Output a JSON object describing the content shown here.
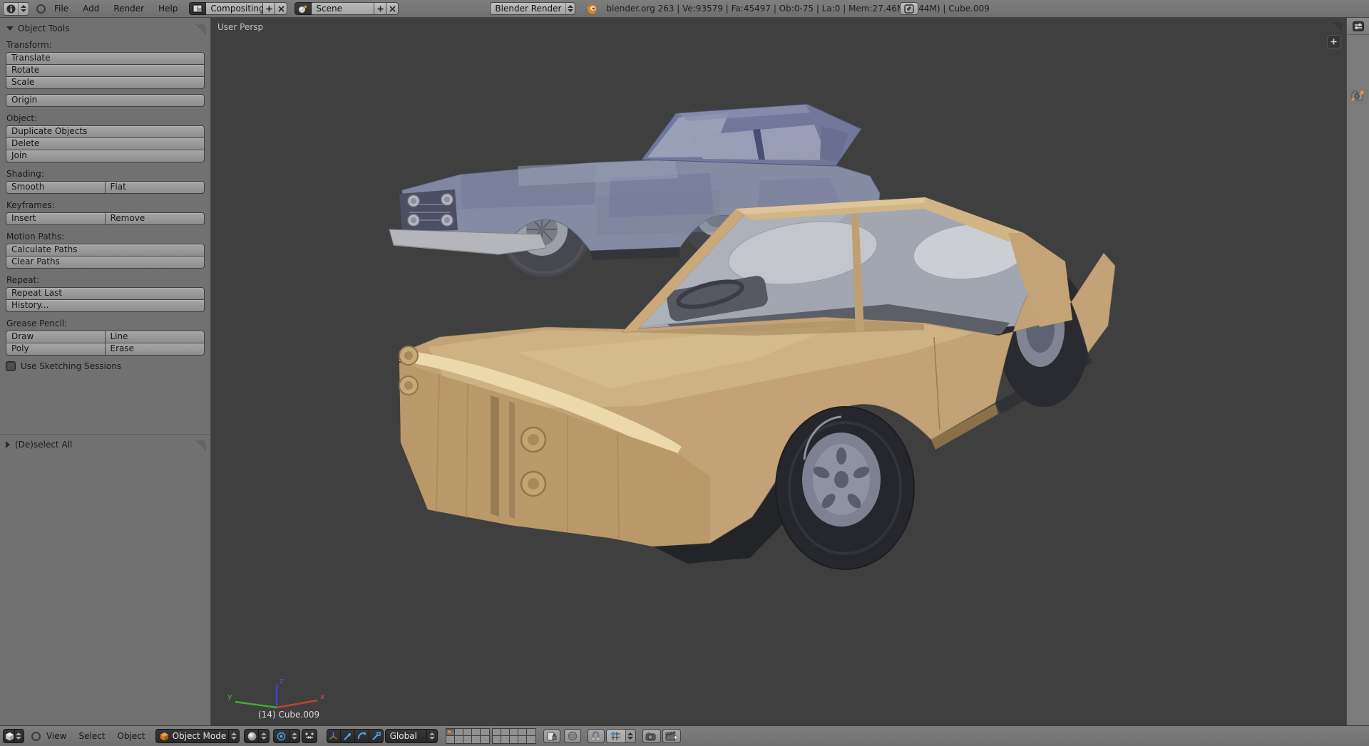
{
  "app": {
    "accent_orange": "#f2871f"
  },
  "top_header": {
    "menus": [
      "File",
      "Add",
      "Render",
      "Help"
    ],
    "screen_layout": {
      "value": "Compositing"
    },
    "scene": {
      "value": "Scene"
    },
    "render_engine": {
      "value": "Blender Render"
    },
    "stats": "blender.org 263 | Ve:93579 | Fa:45497 | Ob:0-75 | La:0 | Mem:27.46M (6.44M) | Cube.009"
  },
  "tool_shelf": {
    "panel_title": "Object Tools",
    "sections": [
      {
        "label": "Transform:",
        "layout": "stack",
        "buttons": [
          "Translate",
          "Rotate",
          "Scale"
        ]
      },
      {
        "label": "",
        "layout": "single",
        "buttons": [
          "Origin"
        ]
      },
      {
        "label": "Object:",
        "layout": "stack",
        "buttons": [
          "Duplicate Objects",
          "Delete",
          "Join"
        ]
      },
      {
        "label": "Shading:",
        "layout": "row",
        "buttons": [
          "Smooth",
          "Flat"
        ]
      },
      {
        "label": "Keyframes:",
        "layout": "row",
        "buttons": [
          "Insert",
          "Remove"
        ]
      },
      {
        "label": "Motion Paths:",
        "layout": "stack",
        "buttons": [
          "Calculate Paths",
          "Clear Paths"
        ]
      },
      {
        "label": "Repeat:",
        "layout": "stack",
        "buttons": [
          "Repeat Last",
          "History..."
        ]
      },
      {
        "label": "Grease Pencil:",
        "layout": "grid2",
        "buttons": [
          "Draw",
          "Line",
          "Poly",
          "Erase"
        ]
      }
    ],
    "sketching_checkbox": {
      "label": "Use Sketching Sessions",
      "checked": false
    },
    "collapsed_panel_title": "(De)select All"
  },
  "viewport": {
    "view_label": "User Persp",
    "active_object": "(14) Cube.009",
    "axis_labels": {
      "x": "x",
      "y": "y",
      "z": "z"
    },
    "background": "#3f3f3f",
    "models": {
      "back_car_color": "#868ba4",
      "front_car_color": "#c2a276"
    }
  },
  "bottom_header": {
    "menus": [
      "View",
      "Select",
      "Object"
    ],
    "mode_selector": {
      "value": "Object Mode"
    },
    "orientation_selector": {
      "value": "Global"
    },
    "layers": {
      "groups": 2,
      "per_group": 10,
      "active": 0
    }
  }
}
